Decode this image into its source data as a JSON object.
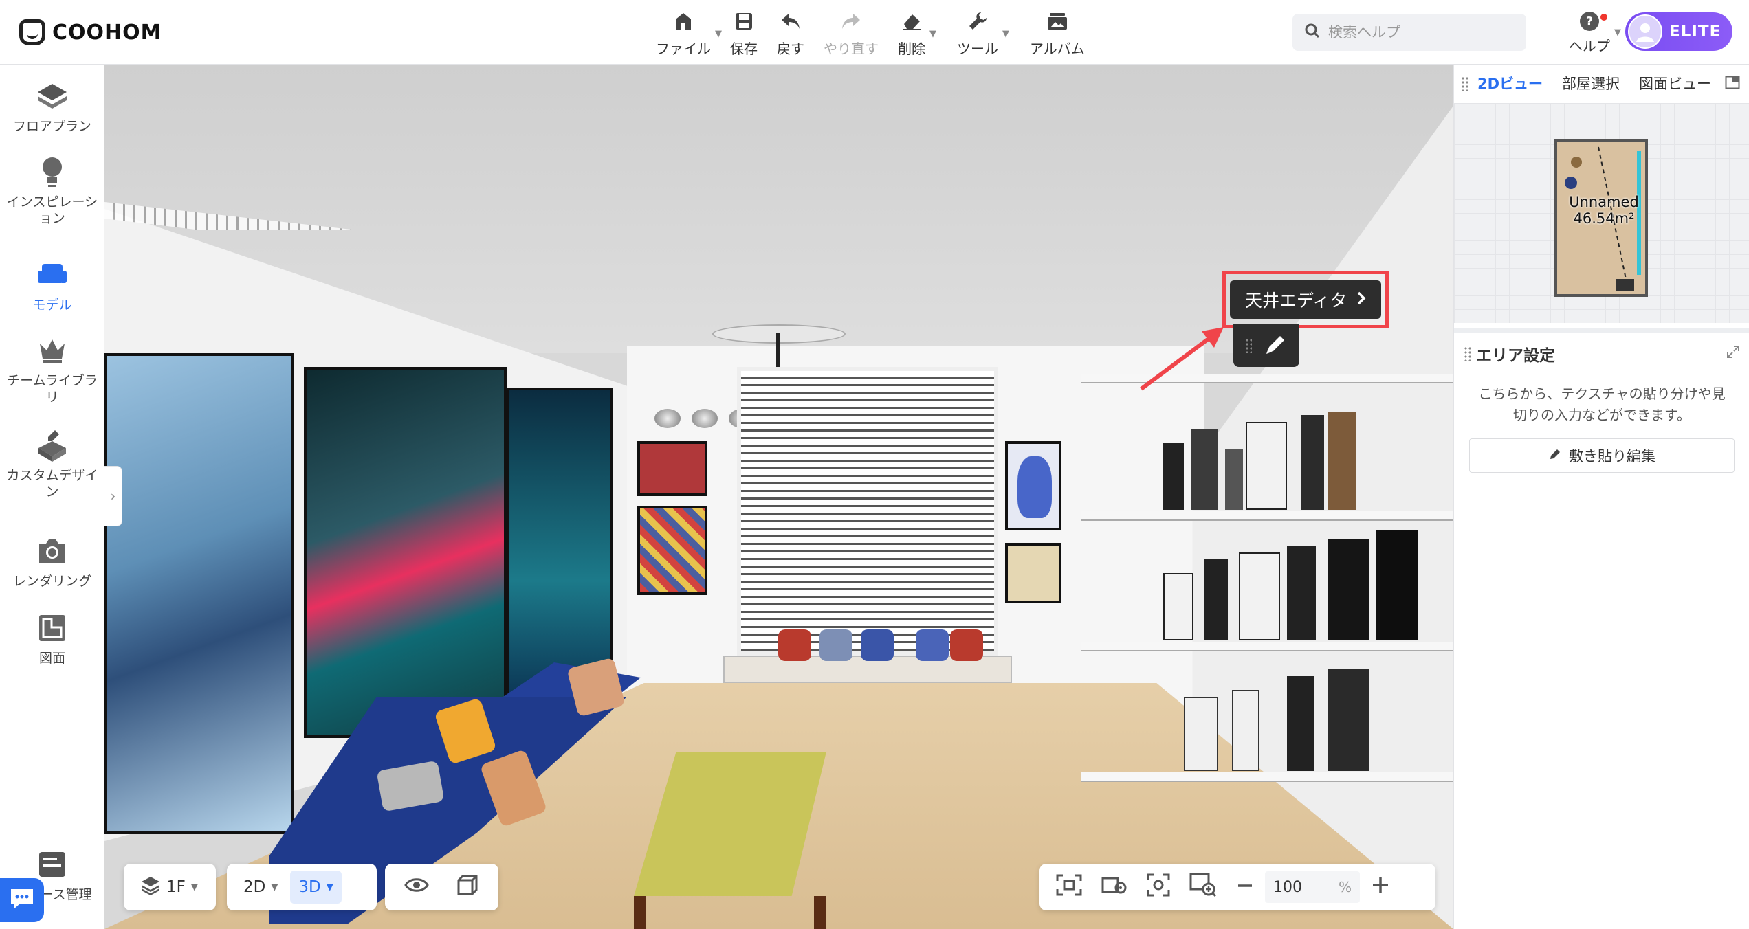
{
  "app": {
    "brand": "COOHOM"
  },
  "toolbar": {
    "file": "ファイル",
    "save": "保存",
    "undo": "戻す",
    "redo": "やり直す",
    "delete": "削除",
    "tools": "ツール",
    "album": "アルバム"
  },
  "search": {
    "placeholder": "検索ヘルプ"
  },
  "help": {
    "label": "ヘルプ"
  },
  "account": {
    "tier": "ELITE"
  },
  "sidebar": {
    "items": [
      {
        "label": "フロアプラン"
      },
      {
        "label": "インスピレーション"
      },
      {
        "label": "モデル"
      },
      {
        "label": "チームライブラリ"
      },
      {
        "label": "カスタムデザイン"
      },
      {
        "label": "レンダリング"
      },
      {
        "label": "図面"
      },
      {
        "label": "ース管理"
      }
    ],
    "active_index": 2
  },
  "viewport": {
    "ceiling_editor": "天井エディタ",
    "floor": "1F",
    "view_2d": "2D",
    "view_3d": "3D",
    "active_view": "3D",
    "zoom_value": "100",
    "zoom_unit": "%"
  },
  "right_panel": {
    "tabs": [
      "2Dビュー",
      "部屋選択",
      "図面ビュー"
    ],
    "active_tab": 0,
    "plan": {
      "room_name": "Unnamed",
      "room_area": "46.54m²"
    },
    "area_settings": {
      "title": "エリア設定",
      "description": "こちらから、テクスチャの貼り分けや見切りの入力などができます。",
      "tile_edit_button": "敷き貼り編集"
    }
  },
  "colors": {
    "accent": "#2a6ff0",
    "elite": "#7a4df2",
    "highlight": "#f0444a"
  },
  "icons": [
    "home-icon",
    "save-icon",
    "undo-icon",
    "redo-icon",
    "eraser-icon",
    "wrench-icon",
    "album-icon",
    "search-icon",
    "help-icon",
    "avatar-icon",
    "layers-icon",
    "eye-icon",
    "cube-icon",
    "pencil-icon",
    "chat-icon"
  ]
}
